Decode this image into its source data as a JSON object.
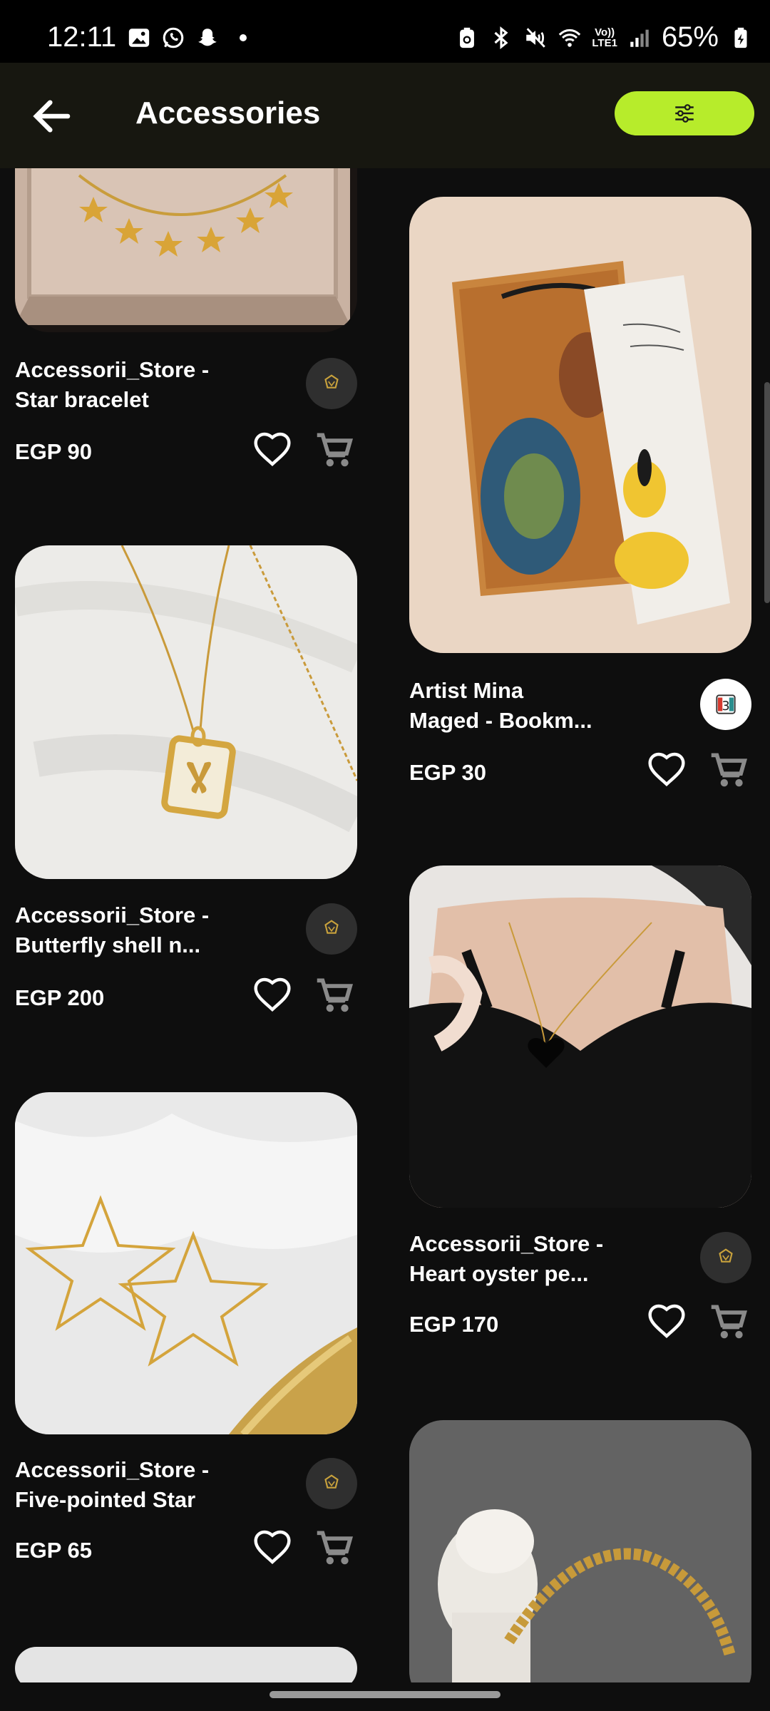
{
  "status_bar": {
    "time": "12:11",
    "battery": "65%",
    "lte_top": "Vo))",
    "lte_bottom": "LTE1"
  },
  "header": {
    "title": "Accessories",
    "back_icon": "arrow-left-icon",
    "filter_icon": "sliders-icon"
  },
  "colors": {
    "accent": "#b7ec2b",
    "background": "#0e0e0e",
    "app_bar": "#171710"
  },
  "products": [
    {
      "title": "Accessorii_Store -\nStar bracelet",
      "price": "EGP 90"
    },
    {
      "title": "Accessorii_Store -\nButterfly shell n...",
      "price": "EGP 200"
    },
    {
      "title": "Accessorii_Store -\nFive-pointed Star",
      "price": "EGP 65"
    },
    {
      "title": "Artist Mina\nMaged  - Bookm...",
      "price": "EGP 30"
    },
    {
      "title": "Accessorii_Store -\nHeart oyster pe...",
      "price": "EGP 170"
    }
  ]
}
